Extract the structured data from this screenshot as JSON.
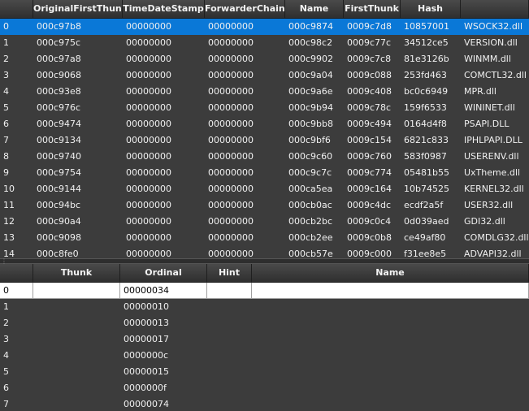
{
  "imports_table": {
    "columns": [
      "",
      "OriginalFirstThunk",
      "TimeDateStamp",
      "ForwarderChain",
      "Name",
      "FirstThunk",
      "Hash",
      ""
    ],
    "rows": [
      [
        "0",
        "000c97b8",
        "00000000",
        "00000000",
        "000c9874",
        "0009c7d8",
        "10857001",
        "WSOCK32.dll"
      ],
      [
        "1",
        "000c975c",
        "00000000",
        "00000000",
        "000c98c2",
        "0009c77c",
        "34512ce5",
        "VERSION.dll"
      ],
      [
        "2",
        "000c97a8",
        "00000000",
        "00000000",
        "000c9902",
        "0009c7c8",
        "81e3126b",
        "WINMM.dll"
      ],
      [
        "3",
        "000c9068",
        "00000000",
        "00000000",
        "000c9a04",
        "0009c088",
        "253fd463",
        "COMCTL32.dll"
      ],
      [
        "4",
        "000c93e8",
        "00000000",
        "00000000",
        "000c9a6e",
        "0009c408",
        "bc0c6949",
        "MPR.dll"
      ],
      [
        "5",
        "000c976c",
        "00000000",
        "00000000",
        "000c9b94",
        "0009c78c",
        "159f6533",
        "WININET.dll"
      ],
      [
        "6",
        "000c9474",
        "00000000",
        "00000000",
        "000c9bb8",
        "0009c494",
        "0164d4f8",
        "PSAPI.DLL"
      ],
      [
        "7",
        "000c9134",
        "00000000",
        "00000000",
        "000c9bf6",
        "0009c154",
        "6821c833",
        "IPHLPAPI.DLL"
      ],
      [
        "8",
        "000c9740",
        "00000000",
        "00000000",
        "000c9c60",
        "0009c760",
        "583f0987",
        "USERENV.dll"
      ],
      [
        "9",
        "000c9754",
        "00000000",
        "00000000",
        "000c9c7c",
        "0009c774",
        "05481b55",
        "UxTheme.dll"
      ],
      [
        "10",
        "000c9144",
        "00000000",
        "00000000",
        "000ca5ea",
        "0009c164",
        "10b74525",
        "KERNEL32.dll"
      ],
      [
        "11",
        "000c94bc",
        "00000000",
        "00000000",
        "000cb0ac",
        "0009c4dc",
        "ecdf2a5f",
        "USER32.dll"
      ],
      [
        "12",
        "000c90a4",
        "00000000",
        "00000000",
        "000cb2bc",
        "0009c0c4",
        "0d039aed",
        "GDI32.dll"
      ],
      [
        "13",
        "000c9098",
        "00000000",
        "00000000",
        "000cb2ee",
        "0009c0b8",
        "ce49af80",
        "COMDLG32.dll"
      ],
      [
        "14",
        "000c8fe0",
        "00000000",
        "00000000",
        "000cb57e",
        "0009c000",
        "f31ee8e5",
        "ADVAPI32.dll"
      ]
    ],
    "selected_row": 0
  },
  "functions_table": {
    "columns": [
      "",
      "Thunk",
      "Ordinal",
      "Hint",
      "Name"
    ],
    "rows": [
      [
        "0",
        "",
        "00000034",
        "",
        ""
      ],
      [
        "1",
        "",
        "00000010",
        "",
        ""
      ],
      [
        "2",
        "",
        "00000013",
        "",
        ""
      ],
      [
        "3",
        "",
        "00000017",
        "",
        ""
      ],
      [
        "4",
        "",
        "0000000c",
        "",
        ""
      ],
      [
        "5",
        "",
        "00000015",
        "",
        ""
      ],
      [
        "6",
        "",
        "0000000f",
        "",
        ""
      ],
      [
        "7",
        "",
        "00000074",
        "",
        ""
      ]
    ]
  },
  "splitter": {
    "grip_glyph": "⋮"
  }
}
